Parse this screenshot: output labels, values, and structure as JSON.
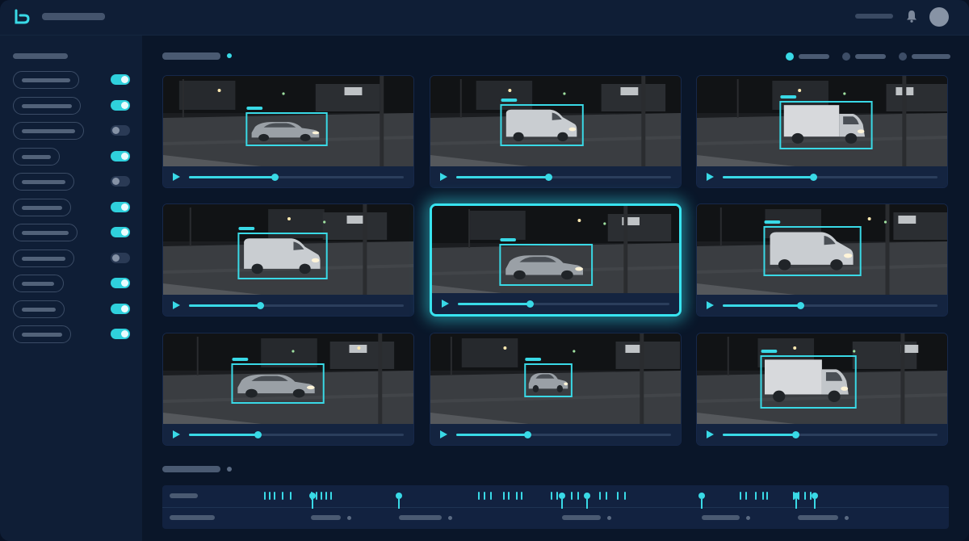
{
  "colors": {
    "accent": "#39d9e6",
    "toggle_on": "#2fd0dc",
    "panel": "#0f1e36",
    "background": "#0a1629"
  },
  "topbar": {
    "logo_icon": "brand-logo-icon",
    "notification_icon": "bell-icon",
    "avatar_icon": "user-avatar"
  },
  "sidebar": {
    "filters": [
      {
        "toggle": "on"
      },
      {
        "toggle": "on"
      },
      {
        "toggle": "off"
      },
      {
        "toggle": "on"
      },
      {
        "toggle": "off"
      },
      {
        "toggle": "on"
      },
      {
        "toggle": "on"
      },
      {
        "toggle": "off"
      },
      {
        "toggle": "on"
      },
      {
        "toggle": "on"
      },
      {
        "toggle": "on"
      }
    ]
  },
  "view_legend": [
    {
      "state": "active"
    },
    {
      "state": "inactive"
    },
    {
      "state": "inactive"
    }
  ],
  "video_grid": {
    "selected_index": 4,
    "feeds": [
      {
        "vehicle": "sedan",
        "progress": 0.4,
        "icon": "play-icon"
      },
      {
        "vehicle": "van",
        "progress": 0.43,
        "icon": "play-icon"
      },
      {
        "vehicle": "box-truck",
        "progress": 0.42,
        "icon": "play-icon"
      },
      {
        "vehicle": "van",
        "progress": 0.33,
        "icon": "play-icon"
      },
      {
        "vehicle": "sedan",
        "progress": 0.34,
        "icon": "play-icon"
      },
      {
        "vehicle": "van",
        "progress": 0.36,
        "icon": "play-icon"
      },
      {
        "vehicle": "sedan",
        "progress": 0.32,
        "icon": "play-icon"
      },
      {
        "vehicle": "sedan",
        "progress": 0.33,
        "icon": "play-icon"
      },
      {
        "vehicle": "box-truck",
        "progress": 0.34,
        "icon": "play-icon"
      }
    ]
  },
  "timeline": {
    "event_count": 7
  }
}
